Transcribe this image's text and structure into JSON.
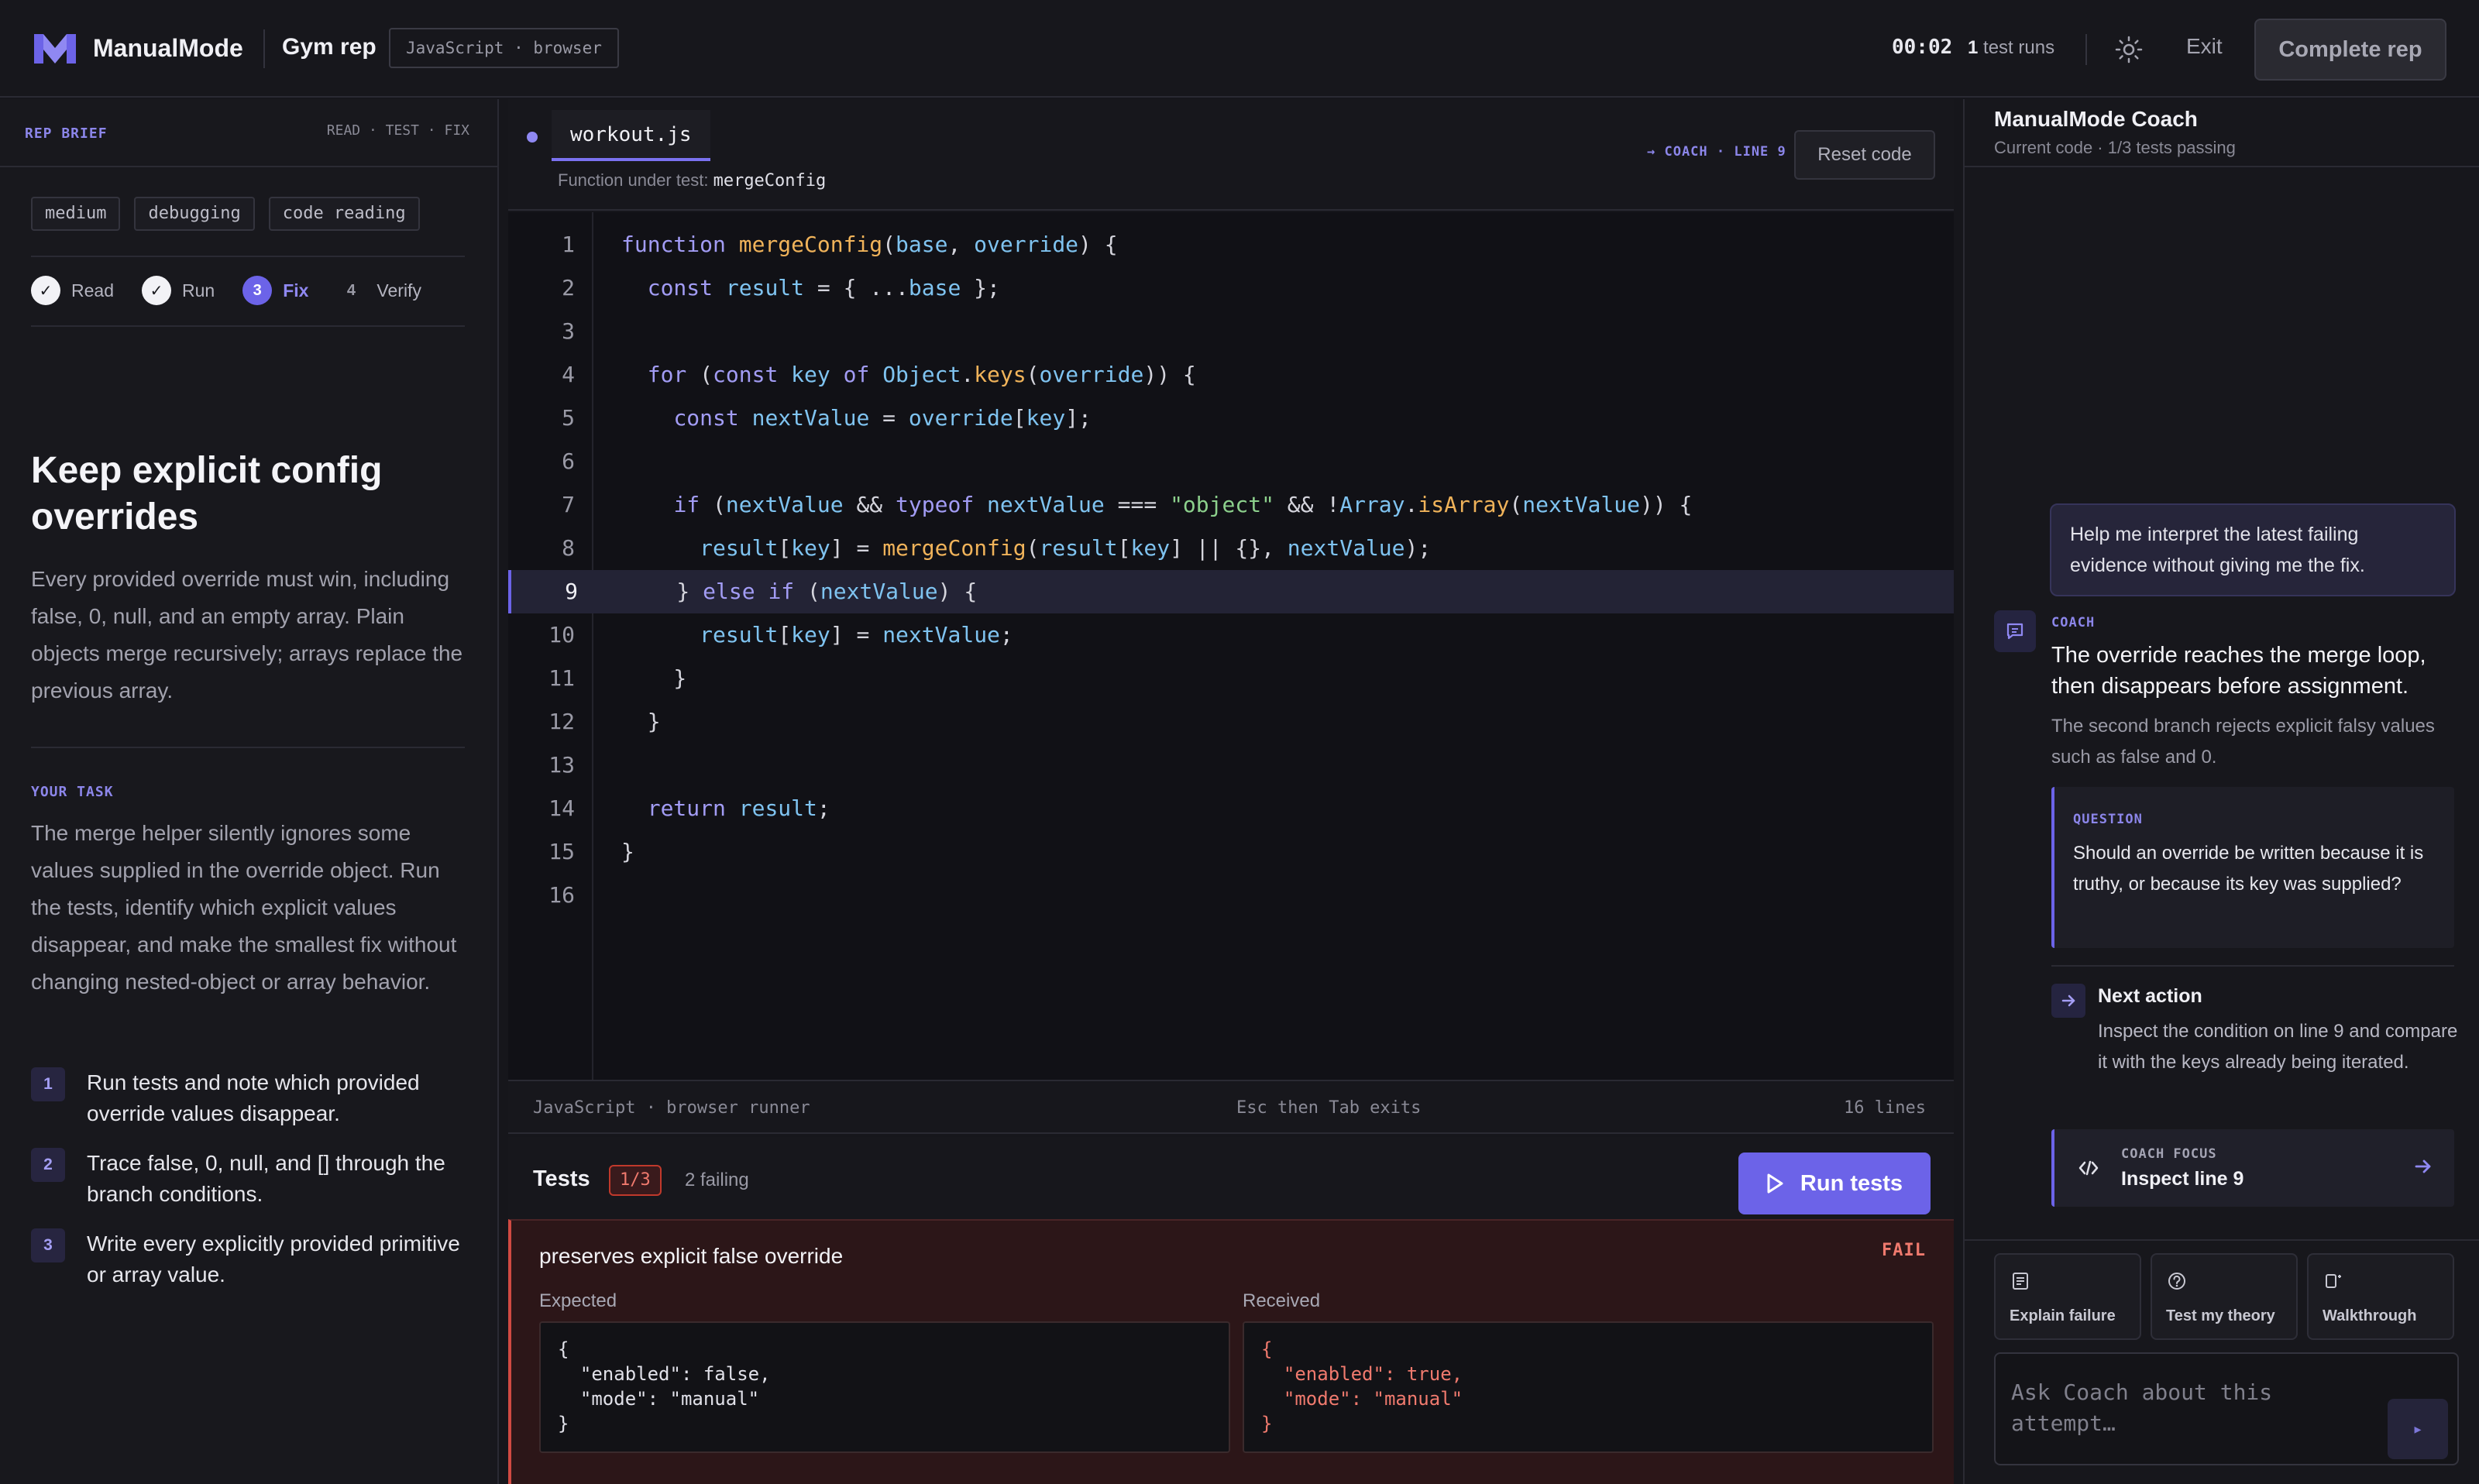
{
  "topbar": {
    "brand": "ManualMode",
    "section": "Gym rep",
    "env_badge": "JavaScript · browser",
    "timer": "00:02",
    "test_runs_count": "1",
    "test_runs_label": "test runs",
    "exit_label": "Exit",
    "complete_label": "Complete rep",
    "icons": {
      "logo": "manualmode-logo",
      "theme": "sun-icon"
    }
  },
  "left": {
    "brief_title": "REP BRIEF",
    "brief_steps": "READ · TEST · FIX",
    "tags": [
      "medium",
      "debugging",
      "code reading"
    ],
    "stepper": [
      {
        "num": "✓",
        "label": "Read",
        "state": "done"
      },
      {
        "num": "✓",
        "label": "Run",
        "state": "done"
      },
      {
        "num": "3",
        "label": "Fix",
        "state": "active"
      },
      {
        "num": "4",
        "label": "Verify",
        "state": "todo"
      }
    ],
    "title": "Keep explicit config overrides",
    "description": "Every provided override must win, including false, 0, null, and an empty array. Plain objects merge recursively; arrays replace the previous array.",
    "task_heading": "YOUR TASK",
    "task_text": "The merge helper silently ignores some values supplied in the override object. Run the tests, identify which explicit values disappear, and make the smallest fix without changing nested-object or array behavior.",
    "task_items": [
      {
        "num": "1",
        "text": "Run tests and note which provided override values disappear."
      },
      {
        "num": "2",
        "text": "Trace false, 0, null, and [] through the branch conditions."
      },
      {
        "num": "3",
        "text": "Write every explicitly provided primitive or array value."
      }
    ]
  },
  "editor": {
    "filename": "workout.js",
    "fn_label": "Function under test:",
    "fn_name": "mergeConfig",
    "coach_line": "→ COACH · LINE 9",
    "reset_label": "Reset code",
    "highlight_line": 9,
    "lines": [
      "function mergeConfig(base, override) {",
      "  const result = { ...base };",
      "",
      "  for (const key of Object.keys(override)) {",
      "    const nextValue = override[key];",
      "",
      "    if (nextValue && typeof nextValue === \"object\" && !Array.isArray(nextValue)) {",
      "      result[key] = mergeConfig(result[key] || {}, nextValue);",
      "    } else if (nextValue) {",
      "      result[key] = nextValue;",
      "    }",
      "  }",
      "",
      "  return result;",
      "}",
      ""
    ],
    "status_left": "JavaScript · browser runner",
    "status_mid": "Esc then Tab exits",
    "status_right": "16 lines"
  },
  "tests": {
    "title": "Tests",
    "badge": "1/3",
    "failing": "2 failing",
    "run_label": "Run tests",
    "failure": {
      "name": "preserves explicit false override",
      "status": "FAIL",
      "expected_label": "Expected",
      "expected": "{\n  \"enabled\": false,\n  \"mode\": \"manual\"\n}",
      "received_label": "Received",
      "received": "{\n  \"enabled\": true,\n  \"mode\": \"manual\"\n}"
    }
  },
  "coach": {
    "title": "ManualMode Coach",
    "subtitle": "Current code · 1/3 tests passing",
    "user_message": "Help me interpret the latest failing evidence without giving me the fix.",
    "label": "COACH",
    "headline": "The override reaches the merge loop, then disappears before assignment.",
    "detail": "The second branch rejects explicit falsy values such as false and 0.",
    "question_label": "QUESTION",
    "question": "Should an override be written because it is truthy, or because its key was supplied?",
    "next_action_title": "Next action",
    "next_action_text": "Inspect the condition on line 9 and compare it with the keys already being iterated.",
    "focus_label": "COACH FOCUS",
    "focus_text": "Inspect line 9",
    "quick_actions": [
      "Explain failure",
      "Test my theory",
      "Walkthrough"
    ],
    "ask_placeholder": "Ask Coach about this attempt…",
    "send_icon": "send-icon"
  },
  "colors": {
    "accent": "#6c63e8",
    "fail": "#d04a42",
    "keyword": "#a29cf4",
    "function": "#f0b35a",
    "variable": "#7fc3f0",
    "string": "#8cd08c"
  }
}
